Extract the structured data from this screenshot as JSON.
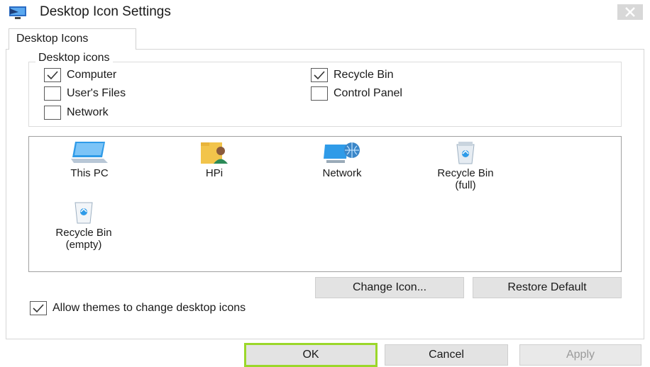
{
  "window": {
    "title": "Desktop Icon Settings",
    "app_icon": "display-settings-icon",
    "close_icon": "close-icon"
  },
  "tabs": [
    {
      "label": "Desktop Icons",
      "selected": true
    }
  ],
  "desktop_icons_group": {
    "legend": "Desktop icons",
    "items": [
      {
        "label": "Computer",
        "checked": true
      },
      {
        "label": "Recycle Bin",
        "checked": true
      },
      {
        "label": "User's Files",
        "checked": false
      },
      {
        "label": "Control Panel",
        "checked": false
      },
      {
        "label": "Network",
        "checked": false
      }
    ]
  },
  "icon_list": [
    {
      "label": "This PC",
      "icon": "monitor-icon"
    },
    {
      "label": "HPi",
      "icon": "user-folder-icon"
    },
    {
      "label": "Network",
      "icon": "network-globe-icon"
    },
    {
      "label": "Recycle Bin (full)",
      "line1": "Recycle Bin",
      "line2": "(full)",
      "icon": "recycle-bin-full-icon"
    },
    {
      "label": "Recycle Bin (empty)",
      "line1": "Recycle Bin",
      "line2": "(empty)",
      "icon": "recycle-bin-empty-icon"
    }
  ],
  "icon_buttons": {
    "change_icon": "Change Icon...",
    "restore_default": "Restore Default"
  },
  "allow_themes": {
    "label": "Allow themes to change desktop icons",
    "checked": true
  },
  "footer_buttons": {
    "ok": "OK",
    "cancel": "Cancel",
    "apply": "Apply",
    "apply_enabled": false
  },
  "colors": {
    "ok_highlight": "#9bd72a",
    "button_face": "#e3e3e3",
    "monitor_blue": "#2f9be8"
  }
}
